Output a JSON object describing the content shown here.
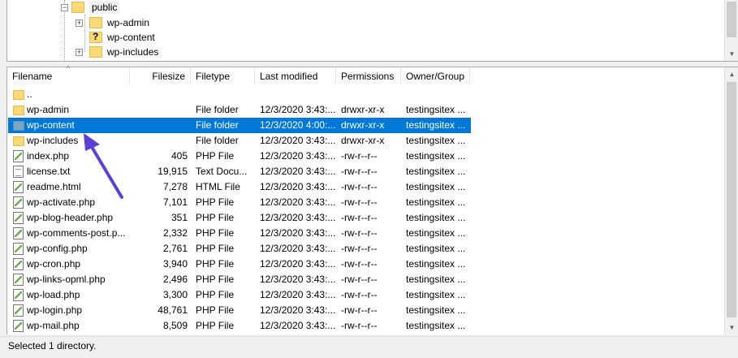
{
  "tree": {
    "nodes": [
      {
        "label": "public",
        "icon": "folder-icon",
        "expanded": true
      },
      {
        "label": "wp-admin",
        "icon": "folder-icon"
      },
      {
        "label": "wp-content",
        "icon": "folder-unknown-icon"
      },
      {
        "label": "wp-includes",
        "icon": "folder-icon"
      }
    ]
  },
  "list": {
    "columns": [
      "Filename",
      "Filesize",
      "Filetype",
      "Last modified",
      "Permissions",
      "Owner/Group"
    ],
    "rows": [
      {
        "name": "..",
        "size": "",
        "type": "",
        "modified": "",
        "perms": "",
        "owner": "",
        "icon": "folder"
      },
      {
        "name": "wp-admin",
        "size": "",
        "type": "File folder",
        "modified": "12/3/2020 3:43:...",
        "perms": "drwxr-xr-x",
        "owner": "testingsitex ...",
        "icon": "folder"
      },
      {
        "name": "wp-content",
        "size": "",
        "type": "File folder",
        "modified": "12/3/2020 4:00:...",
        "perms": "drwxr-xr-x",
        "owner": "testingsitex ...",
        "icon": "folder",
        "selected": true
      },
      {
        "name": "wp-includes",
        "size": "",
        "type": "File folder",
        "modified": "12/3/2020 3:43:...",
        "perms": "drwxr-xr-x",
        "owner": "testingsitex ...",
        "icon": "folder"
      },
      {
        "name": "index.php",
        "size": "405",
        "type": "PHP File",
        "modified": "12/3/2020 3:43:...",
        "perms": "-rw-r--r--",
        "owner": "testingsitex ...",
        "icon": "php"
      },
      {
        "name": "license.txt",
        "size": "19,915",
        "type": "Text Docu...",
        "modified": "12/3/2020 3:43:...",
        "perms": "-rw-r--r--",
        "owner": "testingsitex ...",
        "icon": "txt"
      },
      {
        "name": "readme.html",
        "size": "7,278",
        "type": "HTML File",
        "modified": "12/3/2020 3:43:...",
        "perms": "-rw-r--r--",
        "owner": "testingsitex ...",
        "icon": "php"
      },
      {
        "name": "wp-activate.php",
        "size": "7,101",
        "type": "PHP File",
        "modified": "12/3/2020 3:43:...",
        "perms": "-rw-r--r--",
        "owner": "testingsitex ...",
        "icon": "php"
      },
      {
        "name": "wp-blog-header.php",
        "size": "351",
        "type": "PHP File",
        "modified": "12/3/2020 3:43:...",
        "perms": "-rw-r--r--",
        "owner": "testingsitex ...",
        "icon": "php"
      },
      {
        "name": "wp-comments-post.p...",
        "size": "2,332",
        "type": "PHP File",
        "modified": "12/3/2020 3:43:...",
        "perms": "-rw-r--r--",
        "owner": "testingsitex ...",
        "icon": "php"
      },
      {
        "name": "wp-config.php",
        "size": "2,761",
        "type": "PHP File",
        "modified": "12/3/2020 3:43:...",
        "perms": "-rw-r--r--",
        "owner": "testingsitex ...",
        "icon": "php"
      },
      {
        "name": "wp-cron.php",
        "size": "3,940",
        "type": "PHP File",
        "modified": "12/3/2020 3:43:...",
        "perms": "-rw-r--r--",
        "owner": "testingsitex ...",
        "icon": "php"
      },
      {
        "name": "wp-links-opml.php",
        "size": "2,496",
        "type": "PHP File",
        "modified": "12/3/2020 3:43:...",
        "perms": "-rw-r--r--",
        "owner": "testingsitex ...",
        "icon": "php"
      },
      {
        "name": "wp-load.php",
        "size": "3,300",
        "type": "PHP File",
        "modified": "12/3/2020 3:43:...",
        "perms": "-rw-r--r--",
        "owner": "testingsitex ...",
        "icon": "php"
      },
      {
        "name": "wp-login.php",
        "size": "48,761",
        "type": "PHP File",
        "modified": "12/3/2020 3:43:...",
        "perms": "-rw-r--r--",
        "owner": "testingsitex ...",
        "icon": "php"
      },
      {
        "name": "wp-mail.php",
        "size": "8,509",
        "type": "PHP File",
        "modified": "12/3/2020 3:43:...",
        "perms": "-rw-r--r--",
        "owner": "testingsitex ...",
        "icon": "php"
      }
    ]
  },
  "status": {
    "text": "Selected 1 directory."
  },
  "colors": {
    "selection": "#0078d7",
    "annotation_arrow": "#5b3fd9"
  }
}
